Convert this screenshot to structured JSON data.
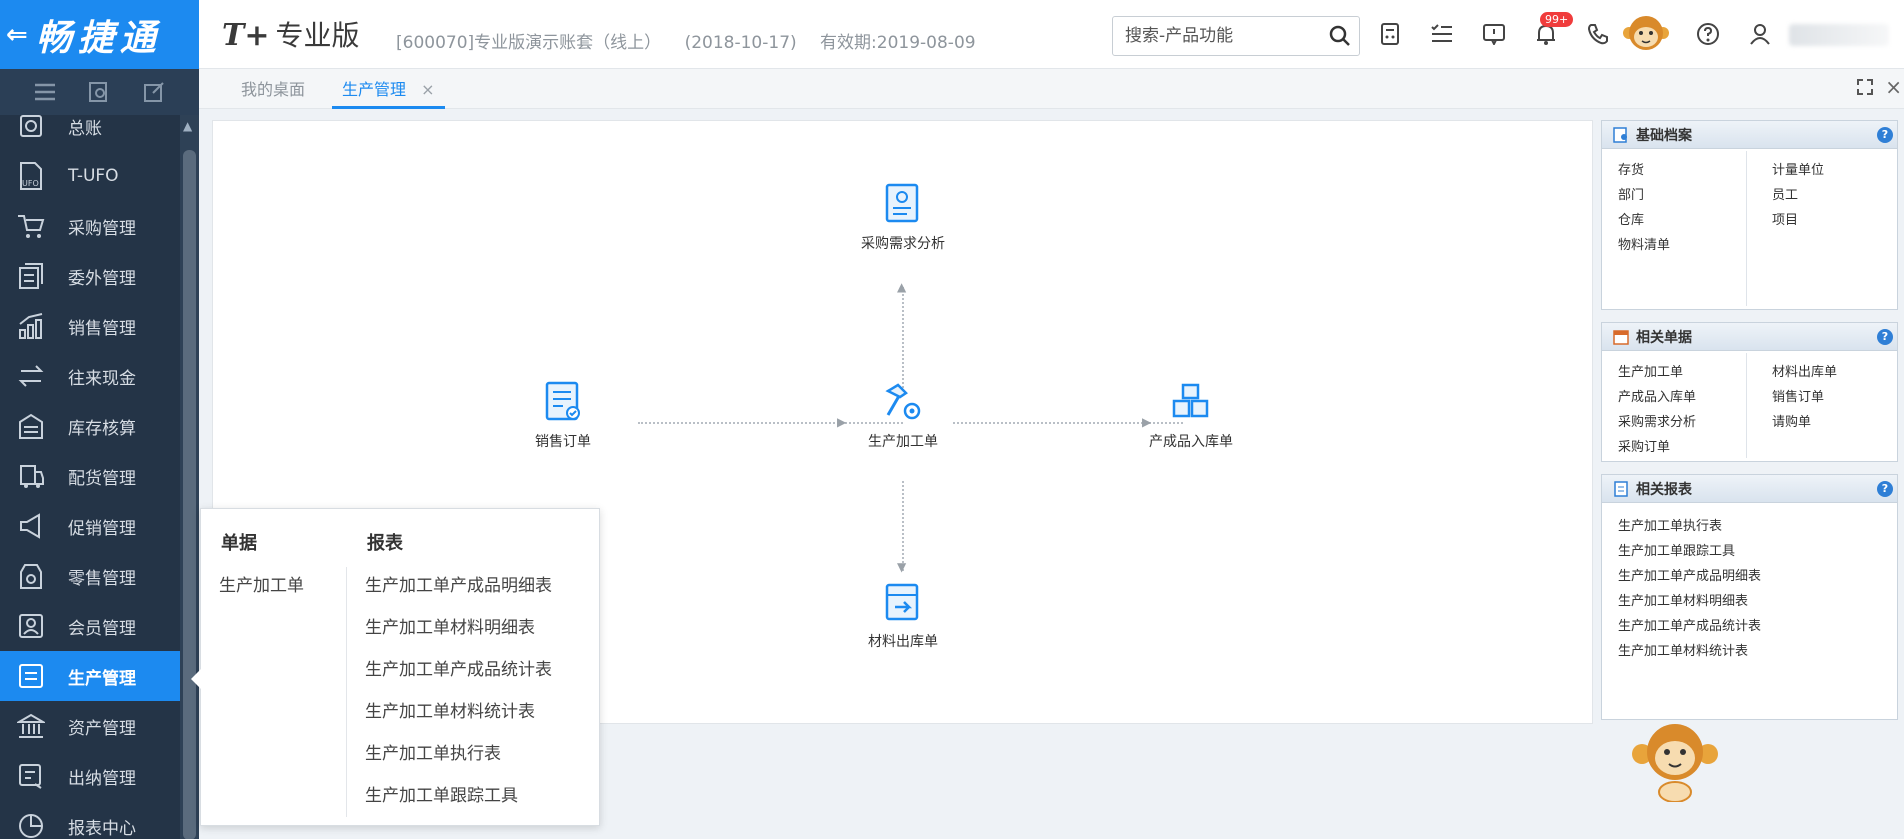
{
  "logo": {
    "back": "⇐",
    "brand": "畅捷通"
  },
  "sidebar": {
    "items": [
      {
        "label": "总账",
        "icon": "ledger-icon"
      },
      {
        "label": "T-UFO",
        "icon": "ufo-icon"
      },
      {
        "label": "采购管理",
        "icon": "cart-icon"
      },
      {
        "label": "委外管理",
        "icon": "outsource-icon"
      },
      {
        "label": "销售管理",
        "icon": "sales-chart-icon"
      },
      {
        "label": "往来现金",
        "icon": "exchange-icon"
      },
      {
        "label": "库存核算",
        "icon": "warehouse-icon"
      },
      {
        "label": "配货管理",
        "icon": "truck-icon"
      },
      {
        "label": "促销管理",
        "icon": "megaphone-icon"
      },
      {
        "label": "零售管理",
        "icon": "store-icon"
      },
      {
        "label": "会员管理",
        "icon": "member-icon"
      },
      {
        "label": "生产管理",
        "icon": "production-icon",
        "active": true
      },
      {
        "label": "资产管理",
        "icon": "bank-icon"
      },
      {
        "label": "出纳管理",
        "icon": "cashier-icon"
      },
      {
        "label": "报表中心",
        "icon": "pie-chart-icon"
      }
    ]
  },
  "header": {
    "product_prefix": "T+",
    "product_name": "专业版",
    "account": "[600070]专业版演示账套（线上）",
    "date": "(2018-10-17)",
    "validity": "有效期:2019-08-09",
    "search_placeholder": "搜索-产品功能",
    "notification_badge": "99+"
  },
  "tabs": [
    {
      "label": "我的桌面"
    },
    {
      "label": "生产管理",
      "active": true,
      "close": "×"
    }
  ],
  "flow": {
    "nodes": {
      "purchase_analysis": "采购需求分析",
      "sales_order": "销售订单",
      "production_order": "生产加工单",
      "product_inbound": "产成品入库单",
      "material_outbound": "材料出库单"
    }
  },
  "popup": {
    "col1_title": "单据",
    "col2_title": "报表",
    "documents": [
      "生产加工单"
    ],
    "reports": [
      "生产加工单产成品明细表",
      "生产加工单材料明细表",
      "生产加工单产成品统计表",
      "生产加工单材料统计表",
      "生产加工单执行表",
      "生产加工单跟踪工具"
    ]
  },
  "right_panels": {
    "basic": {
      "title": "基础档案",
      "left": [
        "存货",
        "部门",
        "仓库",
        "物料清单"
      ],
      "right": [
        "计量单位",
        "员工",
        "项目"
      ]
    },
    "related_docs": {
      "title": "相关单据",
      "left": [
        "生产加工单",
        "产成品入库单",
        "采购需求分析",
        "采购订单"
      ],
      "right": [
        "材料出库单",
        "销售订单",
        "请购单"
      ]
    },
    "related_reports": {
      "title": "相关报表",
      "items": [
        "生产加工单执行表",
        "生产加工单跟踪工具",
        "生产加工单产成品明细表",
        "生产加工单材料明细表",
        "生产加工单产成品统计表",
        "生产加工单材料统计表"
      ]
    },
    "help": "?"
  },
  "colors": {
    "accent": "#1c8af0",
    "sidebar": "#243447",
    "badge": "#f03c3c"
  }
}
